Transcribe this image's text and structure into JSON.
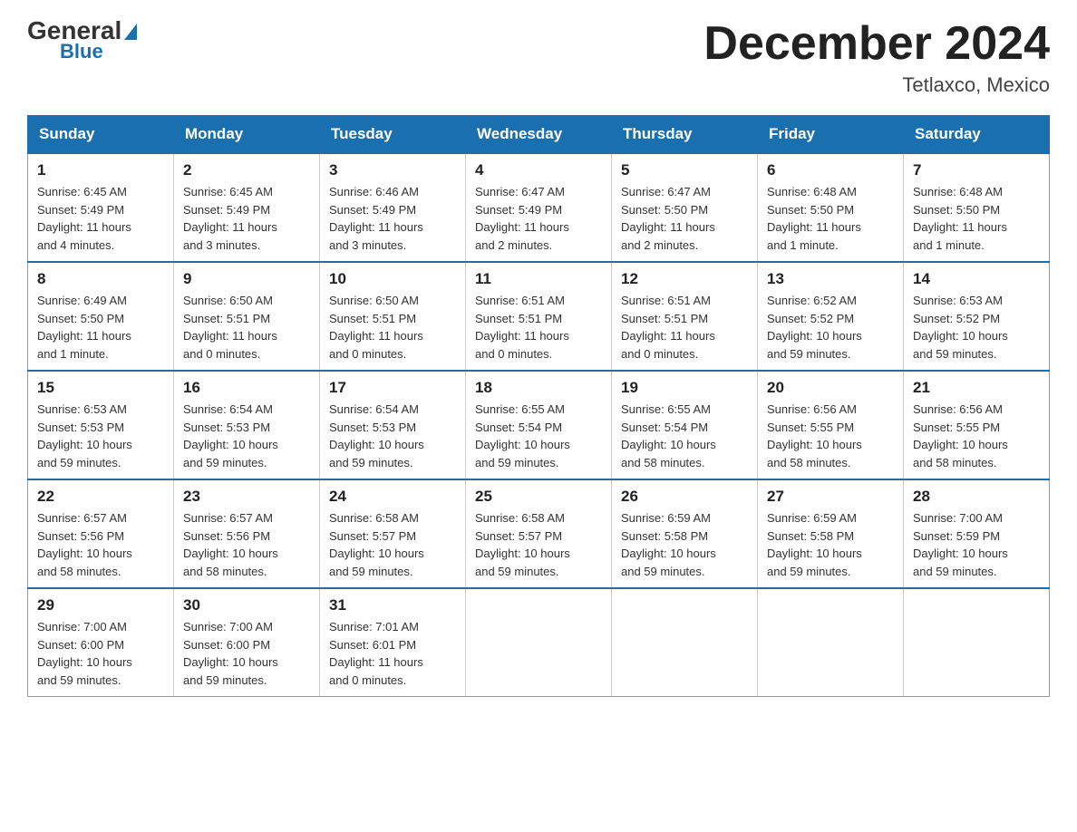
{
  "header": {
    "logo_general": "General",
    "logo_blue": "Blue",
    "month_title": "December 2024",
    "location": "Tetlaxco, Mexico"
  },
  "weekdays": [
    "Sunday",
    "Monday",
    "Tuesday",
    "Wednesday",
    "Thursday",
    "Friday",
    "Saturday"
  ],
  "weeks": [
    [
      {
        "day": "1",
        "info": "Sunrise: 6:45 AM\nSunset: 5:49 PM\nDaylight: 11 hours\nand 4 minutes."
      },
      {
        "day": "2",
        "info": "Sunrise: 6:45 AM\nSunset: 5:49 PM\nDaylight: 11 hours\nand 3 minutes."
      },
      {
        "day": "3",
        "info": "Sunrise: 6:46 AM\nSunset: 5:49 PM\nDaylight: 11 hours\nand 3 minutes."
      },
      {
        "day": "4",
        "info": "Sunrise: 6:47 AM\nSunset: 5:49 PM\nDaylight: 11 hours\nand 2 minutes."
      },
      {
        "day": "5",
        "info": "Sunrise: 6:47 AM\nSunset: 5:50 PM\nDaylight: 11 hours\nand 2 minutes."
      },
      {
        "day": "6",
        "info": "Sunrise: 6:48 AM\nSunset: 5:50 PM\nDaylight: 11 hours\nand 1 minute."
      },
      {
        "day": "7",
        "info": "Sunrise: 6:48 AM\nSunset: 5:50 PM\nDaylight: 11 hours\nand 1 minute."
      }
    ],
    [
      {
        "day": "8",
        "info": "Sunrise: 6:49 AM\nSunset: 5:50 PM\nDaylight: 11 hours\nand 1 minute."
      },
      {
        "day": "9",
        "info": "Sunrise: 6:50 AM\nSunset: 5:51 PM\nDaylight: 11 hours\nand 0 minutes."
      },
      {
        "day": "10",
        "info": "Sunrise: 6:50 AM\nSunset: 5:51 PM\nDaylight: 11 hours\nand 0 minutes."
      },
      {
        "day": "11",
        "info": "Sunrise: 6:51 AM\nSunset: 5:51 PM\nDaylight: 11 hours\nand 0 minutes."
      },
      {
        "day": "12",
        "info": "Sunrise: 6:51 AM\nSunset: 5:51 PM\nDaylight: 11 hours\nand 0 minutes."
      },
      {
        "day": "13",
        "info": "Sunrise: 6:52 AM\nSunset: 5:52 PM\nDaylight: 10 hours\nand 59 minutes."
      },
      {
        "day": "14",
        "info": "Sunrise: 6:53 AM\nSunset: 5:52 PM\nDaylight: 10 hours\nand 59 minutes."
      }
    ],
    [
      {
        "day": "15",
        "info": "Sunrise: 6:53 AM\nSunset: 5:53 PM\nDaylight: 10 hours\nand 59 minutes."
      },
      {
        "day": "16",
        "info": "Sunrise: 6:54 AM\nSunset: 5:53 PM\nDaylight: 10 hours\nand 59 minutes."
      },
      {
        "day": "17",
        "info": "Sunrise: 6:54 AM\nSunset: 5:53 PM\nDaylight: 10 hours\nand 59 minutes."
      },
      {
        "day": "18",
        "info": "Sunrise: 6:55 AM\nSunset: 5:54 PM\nDaylight: 10 hours\nand 59 minutes."
      },
      {
        "day": "19",
        "info": "Sunrise: 6:55 AM\nSunset: 5:54 PM\nDaylight: 10 hours\nand 58 minutes."
      },
      {
        "day": "20",
        "info": "Sunrise: 6:56 AM\nSunset: 5:55 PM\nDaylight: 10 hours\nand 58 minutes."
      },
      {
        "day": "21",
        "info": "Sunrise: 6:56 AM\nSunset: 5:55 PM\nDaylight: 10 hours\nand 58 minutes."
      }
    ],
    [
      {
        "day": "22",
        "info": "Sunrise: 6:57 AM\nSunset: 5:56 PM\nDaylight: 10 hours\nand 58 minutes."
      },
      {
        "day": "23",
        "info": "Sunrise: 6:57 AM\nSunset: 5:56 PM\nDaylight: 10 hours\nand 58 minutes."
      },
      {
        "day": "24",
        "info": "Sunrise: 6:58 AM\nSunset: 5:57 PM\nDaylight: 10 hours\nand 59 minutes."
      },
      {
        "day": "25",
        "info": "Sunrise: 6:58 AM\nSunset: 5:57 PM\nDaylight: 10 hours\nand 59 minutes."
      },
      {
        "day": "26",
        "info": "Sunrise: 6:59 AM\nSunset: 5:58 PM\nDaylight: 10 hours\nand 59 minutes."
      },
      {
        "day": "27",
        "info": "Sunrise: 6:59 AM\nSunset: 5:58 PM\nDaylight: 10 hours\nand 59 minutes."
      },
      {
        "day": "28",
        "info": "Sunrise: 7:00 AM\nSunset: 5:59 PM\nDaylight: 10 hours\nand 59 minutes."
      }
    ],
    [
      {
        "day": "29",
        "info": "Sunrise: 7:00 AM\nSunset: 6:00 PM\nDaylight: 10 hours\nand 59 minutes."
      },
      {
        "day": "30",
        "info": "Sunrise: 7:00 AM\nSunset: 6:00 PM\nDaylight: 10 hours\nand 59 minutes."
      },
      {
        "day": "31",
        "info": "Sunrise: 7:01 AM\nSunset: 6:01 PM\nDaylight: 11 hours\nand 0 minutes."
      },
      {
        "day": "",
        "info": ""
      },
      {
        "day": "",
        "info": ""
      },
      {
        "day": "",
        "info": ""
      },
      {
        "day": "",
        "info": ""
      }
    ]
  ]
}
